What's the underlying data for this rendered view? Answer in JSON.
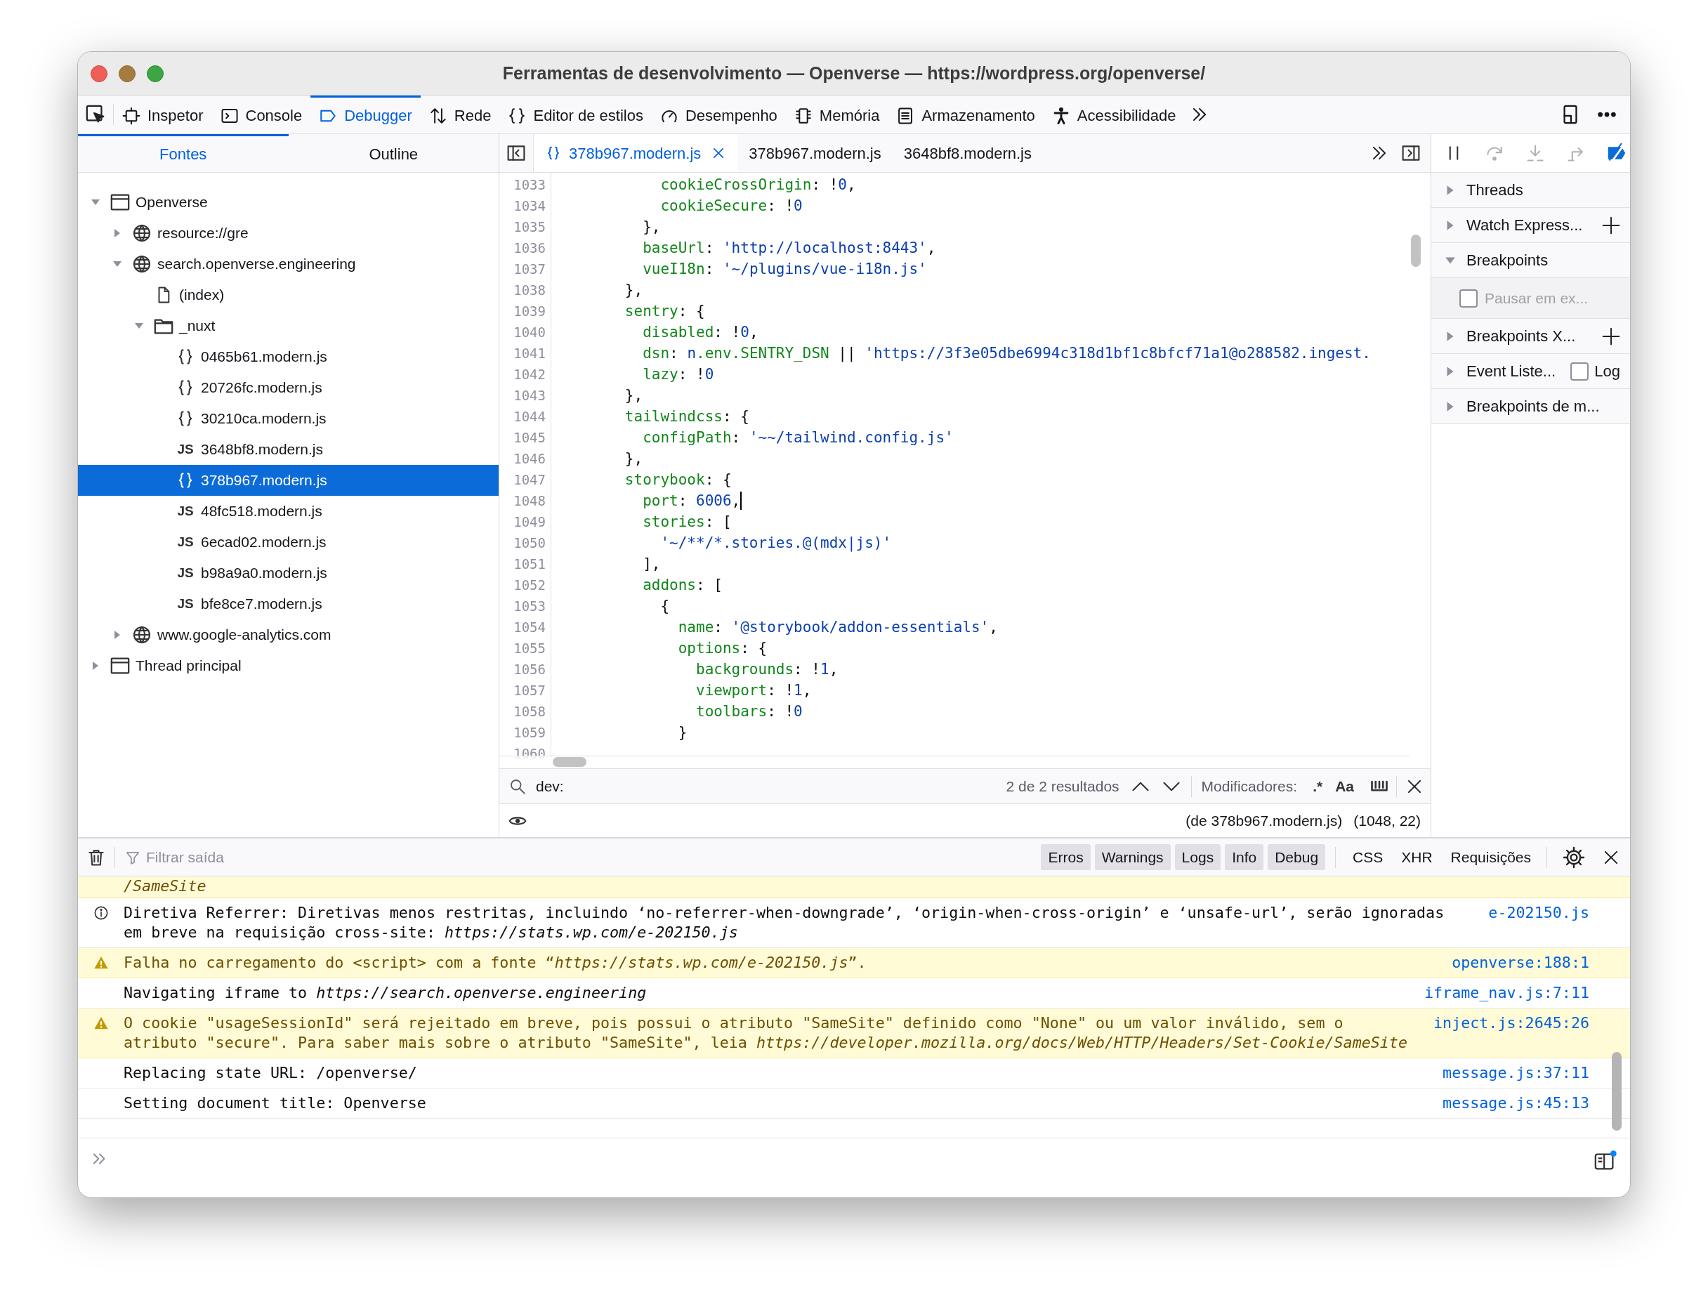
{
  "window": {
    "title": "Ferramentas de desenvolvimento — Openverse — https://wordpress.org/openverse/"
  },
  "toolbar": {
    "tabs": [
      {
        "label": "Inspetor",
        "kind": "inspector",
        "selected": false
      },
      {
        "label": "Console",
        "kind": "console",
        "selected": false
      },
      {
        "label": "Debugger",
        "kind": "debugger",
        "selected": true
      },
      {
        "label": "Rede",
        "kind": "network",
        "selected": false
      },
      {
        "label": "Editor de estilos",
        "kind": "style",
        "selected": false
      },
      {
        "label": "Desempenho",
        "kind": "performance",
        "selected": false
      },
      {
        "label": "Memória",
        "kind": "memory",
        "selected": false
      },
      {
        "label": "Armazenamento",
        "kind": "storage",
        "selected": false
      },
      {
        "label": "Acessibilidade",
        "kind": "accessibility",
        "selected": false
      }
    ]
  },
  "sources_panel": {
    "tabs": [
      {
        "label": "Fontes",
        "selected": true
      },
      {
        "label": "Outline",
        "selected": false
      }
    ],
    "tree": [
      {
        "label": "Openverse",
        "kind": "page",
        "expanded": true,
        "selected": false,
        "children": [
          {
            "label": "resource://gre",
            "kind": "domain",
            "expanded": false,
            "selected": false
          },
          {
            "label": "search.openverse.engineering",
            "kind": "domain",
            "expanded": true,
            "selected": false,
            "children": [
              {
                "label": "(index)",
                "kind": "file",
                "selected": false
              },
              {
                "label": "_nuxt",
                "kind": "folder",
                "expanded": true,
                "selected": false,
                "children": [
                  {
                    "label": "0465b61.modern.js",
                    "kind": "formatted",
                    "selected": false
                  },
                  {
                    "label": "20726fc.modern.js",
                    "kind": "formatted",
                    "selected": false
                  },
                  {
                    "label": "30210ca.modern.js",
                    "kind": "formatted",
                    "selected": false
                  },
                  {
                    "label": "3648bf8.modern.js",
                    "kind": "script",
                    "badge": "JS",
                    "selected": false
                  },
                  {
                    "label": "378b967.modern.js",
                    "kind": "formatted",
                    "selected": true
                  },
                  {
                    "label": "48fc518.modern.js",
                    "kind": "script",
                    "badge": "JS",
                    "selected": false
                  },
                  {
                    "label": "6ecad02.modern.js",
                    "kind": "script",
                    "badge": "JS",
                    "selected": false
                  },
                  {
                    "label": "b98a9a0.modern.js",
                    "kind": "script",
                    "badge": "JS",
                    "selected": false
                  },
                  {
                    "label": "bfe8ce7.modern.js",
                    "kind": "script",
                    "badge": "JS",
                    "selected": false
                  }
                ]
              }
            ]
          },
          {
            "label": "www.google-analytics.com",
            "kind": "domain",
            "expanded": false,
            "selected": false
          }
        ]
      },
      {
        "label": "Thread principal",
        "kind": "page",
        "expanded": false,
        "selected": false
      }
    ]
  },
  "editor": {
    "tabs": [
      {
        "label": "378b967.modern.js",
        "kind": "formatted",
        "selected": true
      },
      {
        "label": "378b967.modern.js",
        "kind": "plain",
        "selected": false
      },
      {
        "label": "3648bf8.modern.js",
        "kind": "plain",
        "selected": false
      }
    ],
    "lines": [
      {
        "number": "1033",
        "caret": false,
        "tokens": [
          {
            "kind": "key",
            "text": "          cookieCrossOrigin"
          },
          {
            "kind": "plain",
            "text": ": !"
          },
          {
            "kind": "number",
            "text": "0"
          },
          {
            "kind": "plain",
            "text": ","
          }
        ]
      },
      {
        "number": "1034",
        "caret": false,
        "tokens": [
          {
            "kind": "key",
            "text": "          cookieSecure"
          },
          {
            "kind": "plain",
            "text": ": !"
          },
          {
            "kind": "number",
            "text": "0"
          }
        ]
      },
      {
        "number": "1035",
        "caret": false,
        "tokens": [
          {
            "kind": "plain",
            "text": "        },"
          }
        ]
      },
      {
        "number": "1036",
        "caret": false,
        "tokens": [
          {
            "kind": "key",
            "text": "        baseUrl"
          },
          {
            "kind": "plain",
            "text": ": "
          },
          {
            "kind": "string",
            "text": "'http://localhost:8443'"
          },
          {
            "kind": "plain",
            "text": ","
          }
        ]
      },
      {
        "number": "1037",
        "caret": false,
        "tokens": [
          {
            "kind": "key",
            "text": "        vueI18n"
          },
          {
            "kind": "plain",
            "text": ": "
          },
          {
            "kind": "string",
            "text": "'~/plugins/vue-i18n.js'"
          }
        ]
      },
      {
        "number": "1038",
        "caret": false,
        "tokens": [
          {
            "kind": "plain",
            "text": "      },"
          }
        ]
      },
      {
        "number": "1039",
        "caret": false,
        "tokens": [
          {
            "kind": "key",
            "text": "      sentry"
          },
          {
            "kind": "plain",
            "text": ": {"
          }
        ]
      },
      {
        "number": "1040",
        "caret": false,
        "tokens": [
          {
            "kind": "key",
            "text": "        disabled"
          },
          {
            "kind": "plain",
            "text": ": !"
          },
          {
            "kind": "number",
            "text": "0"
          },
          {
            "kind": "plain",
            "text": ","
          }
        ]
      },
      {
        "number": "1041",
        "caret": false,
        "tokens": [
          {
            "kind": "key",
            "text": "        dsn"
          },
          {
            "kind": "plain",
            "text": ": "
          },
          {
            "kind": "number",
            "text": "n"
          },
          {
            "kind": "key",
            "text": ".env.SENTRY_DSN"
          },
          {
            "kind": "plain",
            "text": " || "
          },
          {
            "kind": "string",
            "text": "'https://3f3e05dbe6994c318d1bf1c8bfcf71a1@o288582.ingest."
          }
        ]
      },
      {
        "number": "1042",
        "caret": false,
        "tokens": [
          {
            "kind": "key",
            "text": "        lazy"
          },
          {
            "kind": "plain",
            "text": ": !"
          },
          {
            "kind": "number",
            "text": "0"
          }
        ]
      },
      {
        "number": "1043",
        "caret": false,
        "tokens": [
          {
            "kind": "plain",
            "text": "      },"
          }
        ]
      },
      {
        "number": "1044",
        "caret": false,
        "tokens": [
          {
            "kind": "key",
            "text": "      tailwindcss"
          },
          {
            "kind": "plain",
            "text": ": {"
          }
        ]
      },
      {
        "number": "1045",
        "caret": false,
        "tokens": [
          {
            "kind": "key",
            "text": "        configPath"
          },
          {
            "kind": "plain",
            "text": ": "
          },
          {
            "kind": "string",
            "text": "'~~/tailwind.config.js'"
          }
        ]
      },
      {
        "number": "1046",
        "caret": false,
        "tokens": [
          {
            "kind": "plain",
            "text": "      },"
          }
        ]
      },
      {
        "number": "1047",
        "caret": false,
        "tokens": [
          {
            "kind": "key",
            "text": "      storybook"
          },
          {
            "kind": "plain",
            "text": ": {"
          }
        ]
      },
      {
        "number": "1048",
        "caret": true,
        "tokens": [
          {
            "kind": "key",
            "text": "        port"
          },
          {
            "kind": "plain",
            "text": ": "
          },
          {
            "kind": "number",
            "text": "6006"
          },
          {
            "kind": "plain",
            "text": ","
          }
        ]
      },
      {
        "number": "1049",
        "caret": false,
        "tokens": [
          {
            "kind": "key",
            "text": "        stories"
          },
          {
            "kind": "plain",
            "text": ": ["
          }
        ]
      },
      {
        "number": "1050",
        "caret": false,
        "tokens": [
          {
            "kind": "string",
            "text": "          '~/**/*.stories.@(mdx|js)'"
          }
        ]
      },
      {
        "number": "1051",
        "caret": false,
        "tokens": [
          {
            "kind": "plain",
            "text": "        ],"
          }
        ]
      },
      {
        "number": "1052",
        "caret": false,
        "tokens": [
          {
            "kind": "key",
            "text": "        addons"
          },
          {
            "kind": "plain",
            "text": ": ["
          }
        ]
      },
      {
        "number": "1053",
        "caret": false,
        "tokens": [
          {
            "kind": "plain",
            "text": "          {"
          }
        ]
      },
      {
        "number": "1054",
        "caret": false,
        "tokens": [
          {
            "kind": "key",
            "text": "            name"
          },
          {
            "kind": "plain",
            "text": ": "
          },
          {
            "kind": "string",
            "text": "'@storybook/addon-essentials'"
          },
          {
            "kind": "plain",
            "text": ","
          }
        ]
      },
      {
        "number": "1055",
        "caret": false,
        "tokens": [
          {
            "kind": "key",
            "text": "            options"
          },
          {
            "kind": "plain",
            "text": ": {"
          }
        ]
      },
      {
        "number": "1056",
        "caret": false,
        "tokens": [
          {
            "kind": "key",
            "text": "              backgrounds"
          },
          {
            "kind": "plain",
            "text": ": !"
          },
          {
            "kind": "number",
            "text": "1"
          },
          {
            "kind": "plain",
            "text": ","
          }
        ]
      },
      {
        "number": "1057",
        "caret": false,
        "tokens": [
          {
            "kind": "key",
            "text": "              viewport"
          },
          {
            "kind": "plain",
            "text": ": !"
          },
          {
            "kind": "number",
            "text": "1"
          },
          {
            "kind": "plain",
            "text": ","
          }
        ]
      },
      {
        "number": "1058",
        "caret": false,
        "tokens": [
          {
            "kind": "key",
            "text": "              toolbars"
          },
          {
            "kind": "plain",
            "text": ": !"
          },
          {
            "kind": "number",
            "text": "0"
          }
        ]
      },
      {
        "number": "1059",
        "caret": false,
        "tokens": [
          {
            "kind": "plain",
            "text": "            }"
          }
        ]
      },
      {
        "number": "1060",
        "caret": false
      }
    ],
    "search": {
      "value": "dev:",
      "results": "2 de 2 resultados",
      "modifiers_label": "Modificadores:",
      "modifiers": [
        {
          "label": ".*",
          "selected": false
        },
        {
          "label": "Aa",
          "selected": false
        }
      ]
    },
    "status": {
      "source": "(de 378b967.modern.js)",
      "position": "(1048, 22)"
    }
  },
  "debugger_panel": {
    "sections": [
      {
        "label": "Threads",
        "kind": "plain",
        "expanded": false
      },
      {
        "label": "Watch Express...",
        "kind": "add",
        "expanded": false
      },
      {
        "label": "Breakpoints",
        "kind": "plain",
        "expanded": true,
        "content": {
          "label": "Pausar em ex...",
          "checked": false,
          "disabled": true
        }
      },
      {
        "label": "Breakpoints X...",
        "kind": "add",
        "expanded": false
      },
      {
        "label": "Event Liste...",
        "kind": "log",
        "expanded": false,
        "log": {
          "label": "Log",
          "checked": false
        }
      },
      {
        "label": "Breakpoints de m...",
        "kind": "plain",
        "expanded": false
      }
    ]
  },
  "console": {
    "filter": {
      "placeholder": "Filtrar saída"
    },
    "levels": [
      {
        "label": "Erros",
        "selected": true
      },
      {
        "label": "Warnings",
        "selected": true
      },
      {
        "label": "Logs",
        "selected": true
      },
      {
        "label": "Info",
        "selected": true
      },
      {
        "label": "Debug",
        "selected": true
      }
    ],
    "types": [
      {
        "label": "CSS",
        "selected": false
      },
      {
        "label": "XHR",
        "selected": false
      },
      {
        "label": "Requisições",
        "selected": false
      }
    ],
    "messages": [
      {
        "kind": "warning",
        "text": "*/SameSite*"
      },
      {
        "kind": "info",
        "text": "Diretiva Referrer: Diretivas menos restritas, incluindo ‘no-referrer-when-downgrade’, ‘origin-when-cross-origin’ e ‘unsafe-url’, serão ignoradas em breve na requisição cross-site: *https://stats.wp.com/e-202150.js*",
        "source": "e-202150.js"
      },
      {
        "kind": "warning",
        "text": "Falha no carregamento do <script> com a fonte “*https://stats.wp.com/e-202150.js*”.",
        "source": "openverse:188:1"
      },
      {
        "kind": "log",
        "text": "Navigating iframe to *https://search.openverse.engineering*",
        "source": "iframe_nav.js:7:11"
      },
      {
        "kind": "warning",
        "text": "O cookie \"usageSessionId\" será rejeitado em breve, pois possui o atributo \"SameSite\" definido como \"None\" ou um valor inválido, sem o atributo \"secure\". Para saber mais sobre o atributo \"SameSite\", leia *https://developer.mozilla.org/docs/Web/HTTP/Headers/Set-Cookie/SameSite*",
        "source": "inject.js:2645:26"
      },
      {
        "kind": "log",
        "text": "Replacing state URL: /openverse/",
        "source": "message.js:37:11"
      },
      {
        "kind": "log",
        "text": "Setting document title: Openverse",
        "source": "message.js:45:13"
      }
    ]
  }
}
